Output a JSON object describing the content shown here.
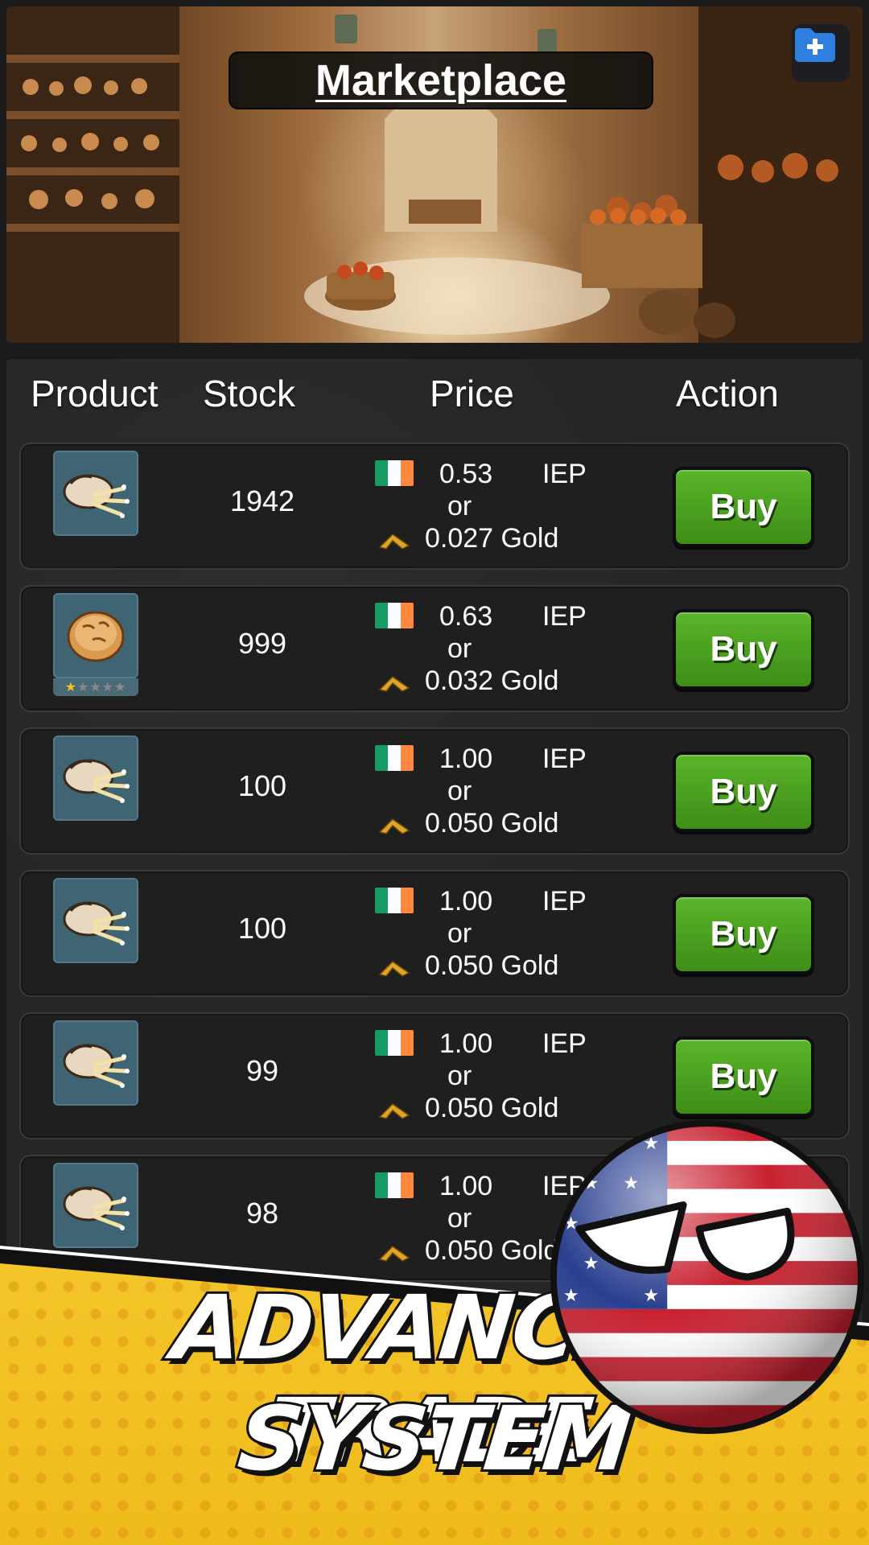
{
  "header": {
    "title": "Marketplace",
    "folder_button_icon": "folder-plus-icon"
  },
  "table": {
    "columns": [
      "Product",
      "Stock",
      "Price",
      "Action"
    ],
    "rows": [
      {
        "product_icon": "wheat-sack-icon",
        "stars": null,
        "stock": "1942",
        "price_amount": "0.53",
        "currency": "IEP",
        "or": "or",
        "gold_price": "0.027 Gold",
        "action": "Buy"
      },
      {
        "product_icon": "bread-icon",
        "stars": "★☆☆☆☆",
        "stock": "999",
        "price_amount": "0.63",
        "currency": "IEP",
        "or": "or",
        "gold_price": "0.032 Gold",
        "action": "Buy"
      },
      {
        "product_icon": "wheat-sack-icon",
        "stars": null,
        "stock": "100",
        "price_amount": "1.00",
        "currency": "IEP",
        "or": "or",
        "gold_price": "0.050 Gold",
        "action": "Buy"
      },
      {
        "product_icon": "wheat-sack-icon",
        "stars": null,
        "stock": "100",
        "price_amount": "1.00",
        "currency": "IEP",
        "or": "or",
        "gold_price": "0.050 Gold",
        "action": "Buy"
      },
      {
        "product_icon": "wheat-sack-icon",
        "stars": null,
        "stock": "99",
        "price_amount": "1.00",
        "currency": "IEP",
        "or": "or",
        "gold_price": "0.050 Gold",
        "action": "Buy"
      },
      {
        "product_icon": "wheat-sack-icon",
        "stars": null,
        "stock": "98",
        "price_amount": "1.00",
        "currency": "IEP",
        "or": "or",
        "gold_price": "0.050 Gold",
        "action": ""
      }
    ]
  },
  "promo": {
    "line1": "ADVANCED TRADE",
    "line2": "SYSTEM"
  },
  "colors": {
    "buy_button": "#4a9e20",
    "banner_yellow": "#f3c629",
    "irish_flag": [
      "#169b62",
      "#ffffff",
      "#ff883e"
    ],
    "gold_icon": "#e0a526"
  }
}
